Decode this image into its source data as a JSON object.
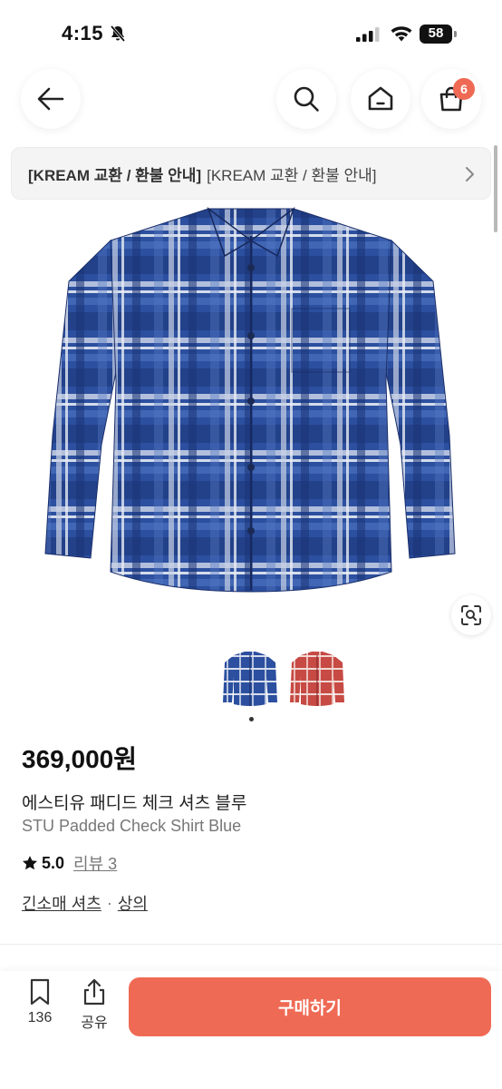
{
  "status_bar": {
    "time": "4:15",
    "battery": "58"
  },
  "nav": {
    "cart_badge": "6"
  },
  "notice": {
    "bold_text": "[KREAM 교환 / 환불 안내]",
    "text": "[KREAM 교환 / 환불 안내]"
  },
  "product": {
    "price": "369,000원",
    "name_ko": "에스티유 패디드 체크 셔츠 블루",
    "name_en": "STU Padded Check Shirt Blue",
    "rating": "5.0",
    "review_link": "리뷰 3",
    "category_primary": "긴소매 셔츠",
    "category_separator": "·",
    "category_secondary": "상의",
    "colors": {
      "blue": "#2b4f9e",
      "red": "#c74a44"
    }
  },
  "bottom_bar": {
    "bookmark_count": "136",
    "share_label": "공유",
    "buy_label": "구매하기",
    "accent_color": "#ef6a54"
  }
}
